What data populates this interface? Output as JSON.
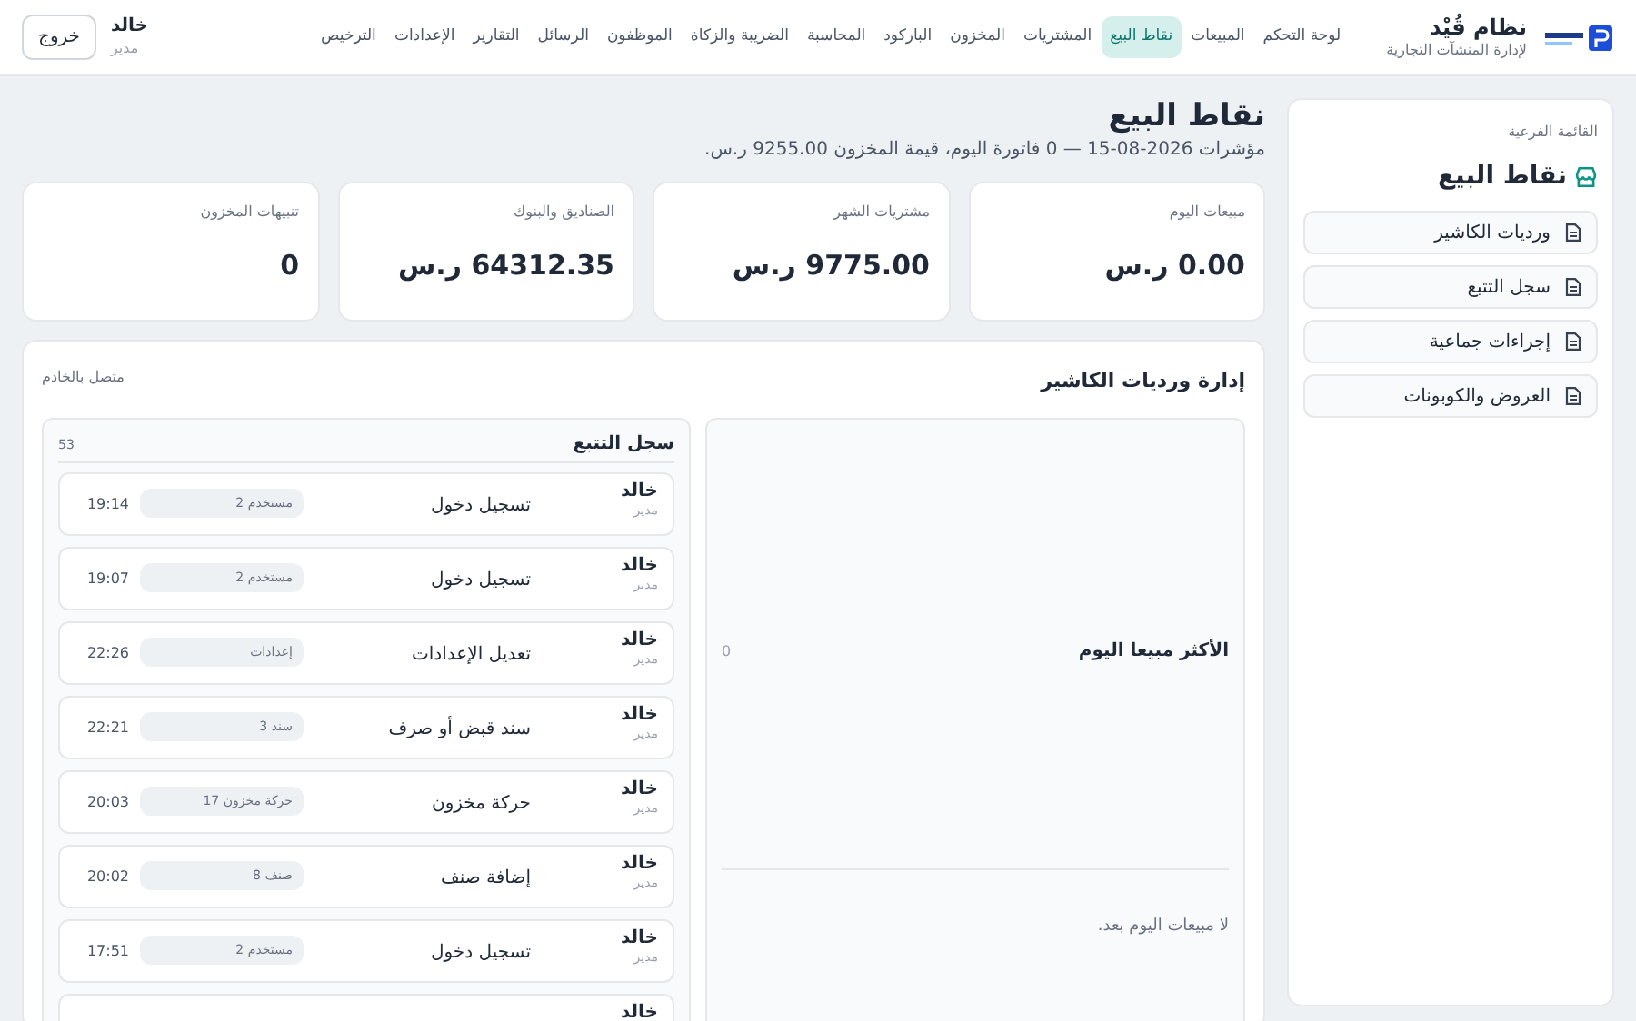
{
  "brand": {
    "title": "نظام قُيْد",
    "subtitle": "لإدارة المنشآت التجارية"
  },
  "nav": [
    {
      "label": "لوحة التحكم",
      "selected": false
    },
    {
      "label": "المبيعات",
      "selected": false
    },
    {
      "label": "نقاط البيع",
      "selected": true
    },
    {
      "label": "المشتريات",
      "selected": false
    },
    {
      "label": "المخزون",
      "selected": false
    },
    {
      "label": "الباركود",
      "selected": false
    },
    {
      "label": "المحاسبة",
      "selected": false
    },
    {
      "label": "الضريبة والزكاة",
      "selected": false
    },
    {
      "label": "الموظفون",
      "selected": false
    },
    {
      "label": "الرسائل",
      "selected": false
    },
    {
      "label": "التقارير",
      "selected": false
    },
    {
      "label": "الإعدادات",
      "selected": false
    },
    {
      "label": "الترخيص",
      "selected": false
    }
  ],
  "user": {
    "name": "خالد",
    "role": "مدير"
  },
  "logout": "خروج",
  "sidebar": {
    "caption": "القائمة الفرعية",
    "title": "نقاط البيع",
    "items": [
      {
        "label": "ورديات الكاشير"
      },
      {
        "label": "سجل التتبع"
      },
      {
        "label": "إجراءات جماعية"
      },
      {
        "label": "العروض والكوبونات"
      }
    ]
  },
  "page": {
    "title": "نقاط البيع",
    "subtitle": "مؤشرات 2026-08-15 — 0 فاتورة اليوم، قيمة المخزون 9255.00 ر.س."
  },
  "stats": [
    {
      "label": "مبيعات اليوم",
      "value": "0.00 ر.س"
    },
    {
      "label": "مشتريات الشهر",
      "value": "9775.00 ر.س"
    },
    {
      "label": "الصناديق والبنوك",
      "value": "64312.35 ر.س"
    },
    {
      "label": "تنبيهات المخزون",
      "value": "0"
    }
  ],
  "panel": {
    "title": "إدارة ورديات الكاشير",
    "status": "متصل بالخادم",
    "top_selling": {
      "title": "الأكثر مبيعا اليوم",
      "count": "0",
      "empty": "لا مبيعات اليوم بعد."
    },
    "log": {
      "title": "سجل التتبع",
      "count": "53",
      "rows": [
        {
          "user": "خالد",
          "role": "مدير",
          "action": "تسجيل دخول",
          "tag": "مستخدم 2",
          "time": "19:14"
        },
        {
          "user": "خالد",
          "role": "مدير",
          "action": "تسجيل دخول",
          "tag": "مستخدم 2",
          "time": "19:07"
        },
        {
          "user": "خالد",
          "role": "مدير",
          "action": "تعديل الإعدادات",
          "tag": "إعدادات",
          "time": "22:26"
        },
        {
          "user": "خالد",
          "role": "مدير",
          "action": "سند قبض أو صرف",
          "tag": "سند 3",
          "time": "22:21"
        },
        {
          "user": "خالد",
          "role": "مدير",
          "action": "حركة مخزون",
          "tag": "حركة مخزون 17",
          "time": "20:03"
        },
        {
          "user": "خالد",
          "role": "مدير",
          "action": "إضافة صنف",
          "tag": "صنف 8",
          "time": "20:02"
        },
        {
          "user": "خالد",
          "role": "مدير",
          "action": "تسجيل دخول",
          "tag": "مستخدم 2",
          "time": "17:51"
        },
        {
          "user": "خالد"
        }
      ]
    }
  }
}
